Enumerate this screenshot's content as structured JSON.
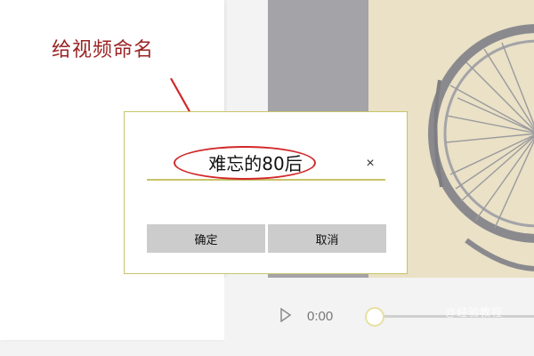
{
  "annotation": {
    "label": "给视频命名",
    "color": "#9a2323",
    "arrow_color": "#d22828"
  },
  "dialog": {
    "name_value": "难忘的80后",
    "clear_icon": "close-icon",
    "clear_glyph": "×",
    "confirm_label": "确定",
    "cancel_label": "取消",
    "border_color": "#c8c46a"
  },
  "playback": {
    "time": "0:00",
    "play_icon": "play-icon",
    "progress": 0,
    "watermark": "@经验教程"
  },
  "colors": {
    "gray_strip": "#a3a3a8",
    "photo_bg": "#ece3c8",
    "slider_knob_border": "#e6e0a2"
  }
}
